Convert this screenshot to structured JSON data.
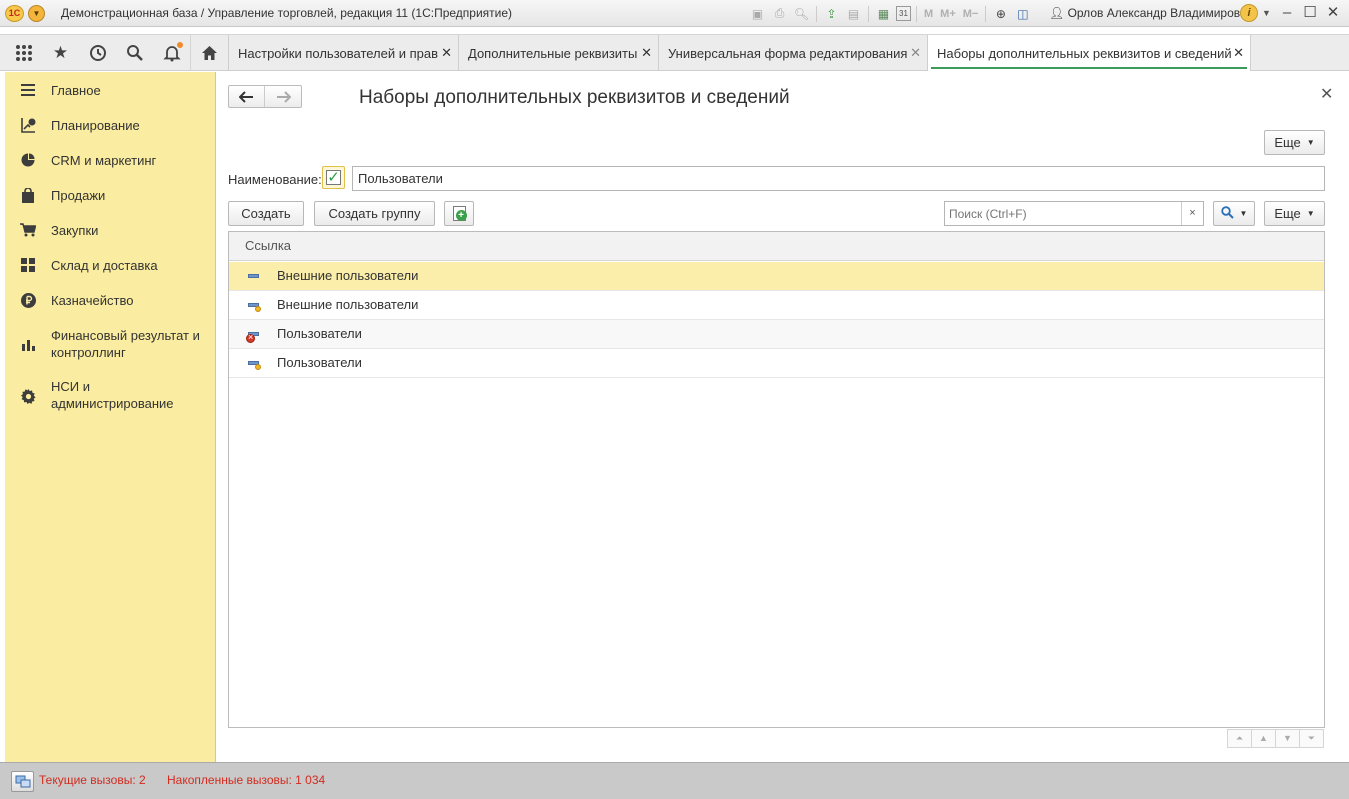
{
  "window": {
    "app_logo": "1С",
    "title": "Демонстрационная база / Управление торговлей, редакция 11  (1С:Предприятие)",
    "user": "Орлов Александр Владимирович",
    "memory_buttons": [
      "M",
      "M+",
      "M−"
    ],
    "calendar_day": "31"
  },
  "nav_tabs": [
    {
      "label": "Настройки пользователей и прав",
      "active": false
    },
    {
      "label": "Дополнительные реквизиты",
      "active": false
    },
    {
      "label": "Универсальная форма редактирования",
      "active": false
    },
    {
      "label": "Наборы дополнительных реквизитов и сведений",
      "active": true
    }
  ],
  "sidebar": {
    "items": [
      {
        "label": "Главное",
        "icon": "menu-lines-icon"
      },
      {
        "label": "Планирование",
        "icon": "planning-icon"
      },
      {
        "label": "CRM и маркетинг",
        "icon": "pie-chart-icon"
      },
      {
        "label": "Продажи",
        "icon": "shopping-bag-icon"
      },
      {
        "label": "Закупки",
        "icon": "cart-icon"
      },
      {
        "label": "Склад и доставка",
        "icon": "warehouse-grid-icon"
      },
      {
        "label": "Казначейство",
        "icon": "ruble-icon"
      },
      {
        "label": "Финансовый результат и контроллинг",
        "icon": "bar-chart-icon"
      },
      {
        "label": "НСИ и администрирование",
        "icon": "gear-icon"
      }
    ]
  },
  "form": {
    "title": "Наборы дополнительных реквизитов и сведений",
    "more_label": "Еще",
    "name_label": "Наименование:",
    "name_checked": true,
    "name_value": "Пользователи",
    "create_label": "Создать",
    "create_group_label": "Создать группу",
    "search_placeholder": "Поиск (Ctrl+F)",
    "search_clear": "×",
    "list_more_label": "Еще"
  },
  "table": {
    "column_header": "Ссылка",
    "rows": [
      {
        "label": "Внешние пользователи",
        "icon": "group-icon",
        "selected": true
      },
      {
        "label": "Внешние пользователи",
        "icon": "set-item-icon",
        "selected": false
      },
      {
        "label": "Пользователи",
        "icon": "set-item-deleted-icon",
        "selected": false
      },
      {
        "label": "Пользователи",
        "icon": "set-item-icon",
        "selected": false
      }
    ]
  },
  "status": {
    "current_calls": "Текущие вызовы: 2",
    "accumulated_calls": "Накопленные вызовы: 1 034"
  }
}
